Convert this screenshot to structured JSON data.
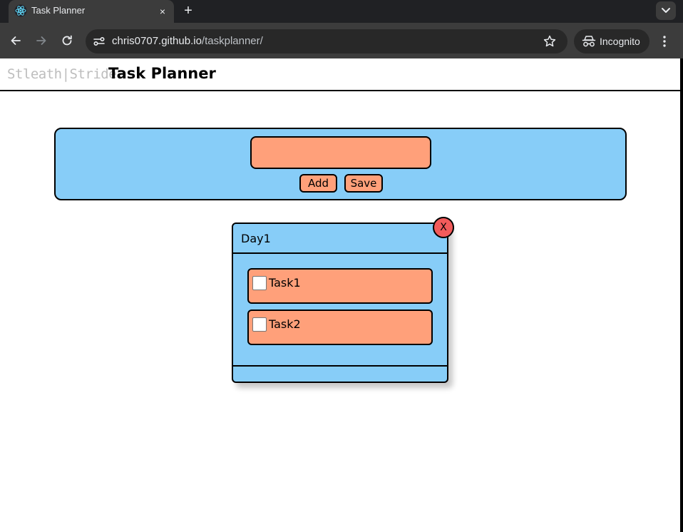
{
  "browser": {
    "tab_title": "Task Planner",
    "tab_close": "×",
    "new_tab": "+",
    "url_host": "chris0707.github.io",
    "url_path": "/taskplanner/",
    "incognito_label": "Incognito",
    "icons": [
      "react-favicon-icon",
      "back-arrow-icon",
      "forward-arrow-icon",
      "reload-icon",
      "site-info-icon",
      "star-icon",
      "incognito-icon",
      "kebab-menu-icon",
      "chevron-down-icon"
    ]
  },
  "header": {
    "brand": "Stleath|Stride",
    "title": "Task Planner"
  },
  "task_bar": {
    "input_value": "",
    "add_label": "Add",
    "save_label": "Save"
  },
  "day_card": {
    "title": "Day1",
    "close_label": "X",
    "tasks": [
      {
        "label": "Task1",
        "checked": false
      },
      {
        "label": "Task2",
        "checked": false
      }
    ]
  },
  "colors": {
    "panel": "#87cdf8",
    "accent": "#ffa07a",
    "close": "#f25b5b",
    "brand_gray": "#bdbdbd"
  }
}
